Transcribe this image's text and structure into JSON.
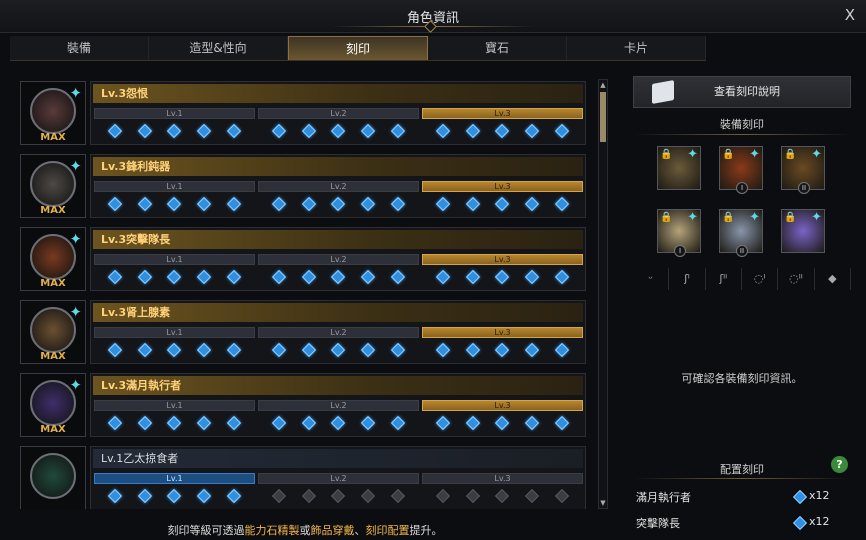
{
  "window": {
    "title": "角色資訊",
    "close": "X"
  },
  "tabs": [
    {
      "label": "裝備"
    },
    {
      "label": "造型&性向"
    },
    {
      "label": "刻印",
      "active": true
    },
    {
      "label": "寶石"
    },
    {
      "label": "卡片"
    }
  ],
  "level_labels": [
    "Lv.1",
    "Lv.2",
    "Lv.3"
  ],
  "engravings": [
    {
      "name": "Lv.3怨恨",
      "badge": "MAX",
      "level": 3,
      "color": "#5a3a3a"
    },
    {
      "name": "Lv.3鋒利鈍器",
      "badge": "MAX",
      "level": 3,
      "color": "#4e4a45"
    },
    {
      "name": "Lv.3突擊隊長",
      "badge": "MAX",
      "level": 3,
      "color": "#7a3a1f"
    },
    {
      "name": "Lv.3肾上腺素",
      "badge": "MAX",
      "level": 3,
      "color": "#6b5031"
    },
    {
      "name": "Lv.3滿月執行者",
      "badge": "MAX",
      "level": 3,
      "color": "#3f2f6b"
    },
    {
      "name": "Lv.1乙太掠食者",
      "badge": "",
      "level": 1,
      "color": "#1f4a3c"
    }
  ],
  "right": {
    "view_button": "查看刻印說明",
    "equip_heading": "裝備刻印",
    "slots": [
      {
        "icon": "necklace-icon",
        "rank": ""
      },
      {
        "icon": "earring-icon",
        "rank": "I"
      },
      {
        "icon": "earring-icon",
        "rank": "II"
      },
      {
        "icon": "ring-icon",
        "rank": "I"
      },
      {
        "icon": "ring-icon",
        "rank": "II"
      },
      {
        "icon": "stone-icon",
        "rank": ""
      }
    ],
    "categories": [
      "necklace",
      "earring-1",
      "earring-2",
      "ring-1",
      "ring-2",
      "stone"
    ],
    "info_text": "可確認各裝備刻印資訊。",
    "config_heading": "配置刻印",
    "help": "?",
    "configured": [
      {
        "name": "滿月執行者",
        "count": "x12"
      },
      {
        "name": "突擊隊長",
        "count": "x12"
      }
    ]
  },
  "footer": {
    "p1": "刻印等級可透過",
    "h1": "能力石精製",
    "p2": "或",
    "h2": "飾品穿戴",
    "p3": "、",
    "h3": "刻印配置",
    "p4": "提升。"
  }
}
